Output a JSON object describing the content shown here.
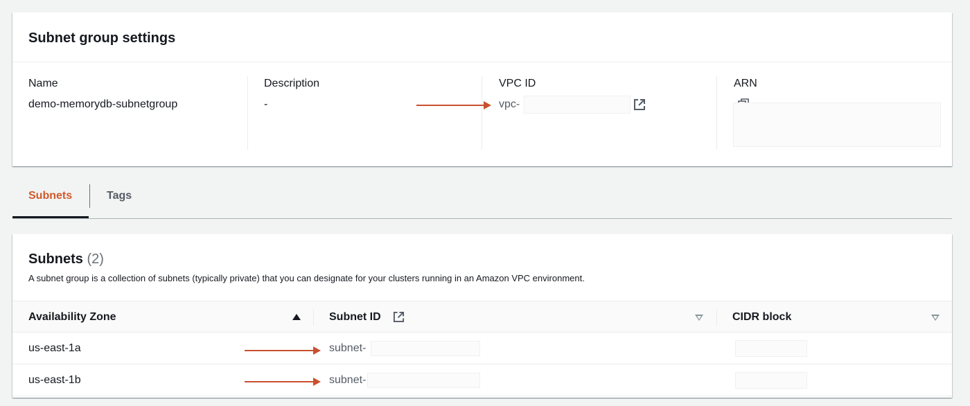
{
  "settings": {
    "title": "Subnet group settings",
    "name_label": "Name",
    "name_value": "demo-memorydb-subnetgroup",
    "description_label": "Description",
    "description_value": "-",
    "vpc_label": "VPC ID",
    "vpc_value": "vpc-",
    "arn_label": "ARN"
  },
  "tabs": [
    {
      "label": "Subnets",
      "active": true
    },
    {
      "label": "Tags",
      "active": false
    }
  ],
  "subnets": {
    "title": "Subnets",
    "count": "(2)",
    "description": "A subnet group is a collection of subnets (typically private) that you can designate for your clusters running in an Amazon VPC environment.",
    "columns": [
      "Availability Zone",
      "Subnet ID",
      "CIDR block"
    ],
    "rows": [
      {
        "az": "us-east-1a",
        "subnet_id": "subnet-",
        "cidr": ""
      },
      {
        "az": "us-east-1b",
        "subnet_id": "subnet-",
        "cidr": ""
      }
    ]
  },
  "colors": {
    "accent": "#d05a2a",
    "arrow": "#c9502e",
    "background": "#f2f3f3"
  }
}
